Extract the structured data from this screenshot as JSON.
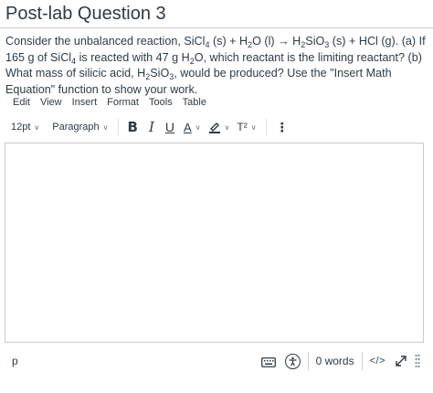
{
  "question": {
    "title": "Post-lab Question 3",
    "body": [
      "Consider the unbalanced reaction, SiCl",
      "4",
      " (s) + H",
      "2",
      "O (l) → H",
      "2",
      "SiO",
      "3",
      " (s) + HCl (g). (a) If 165 g of SiCl",
      "4",
      " is reacted with 47 g H",
      "2",
      "O, which reactant is the limiting reactant? (b) What mass of silicic acid, H",
      "2",
      "SiO",
      "3",
      ", would be produced? Use the \"Insert Math Equation\" function to show your work."
    ]
  },
  "menubar": [
    "Edit",
    "View",
    "Insert",
    "Format",
    "Tools",
    "Table"
  ],
  "toolbar": {
    "font_size": "12pt",
    "block_format": "Paragraph",
    "bold": "B",
    "italic": "I",
    "underline": "U",
    "text_color": "A",
    "superscript": "T²",
    "more": "⋮"
  },
  "editor": {
    "content": ""
  },
  "statusbar": {
    "path": "p",
    "word_count": "0 words",
    "html_toggle": "</>"
  },
  "icons": {
    "keyboard": "keyboard-icon",
    "accessibility": "accessibility-checker-icon",
    "fullscreen": "expand-icon",
    "resize": "resize-grip-icon"
  },
  "colors": {
    "text": "#2d3b45",
    "border": "#c7cdd1"
  }
}
